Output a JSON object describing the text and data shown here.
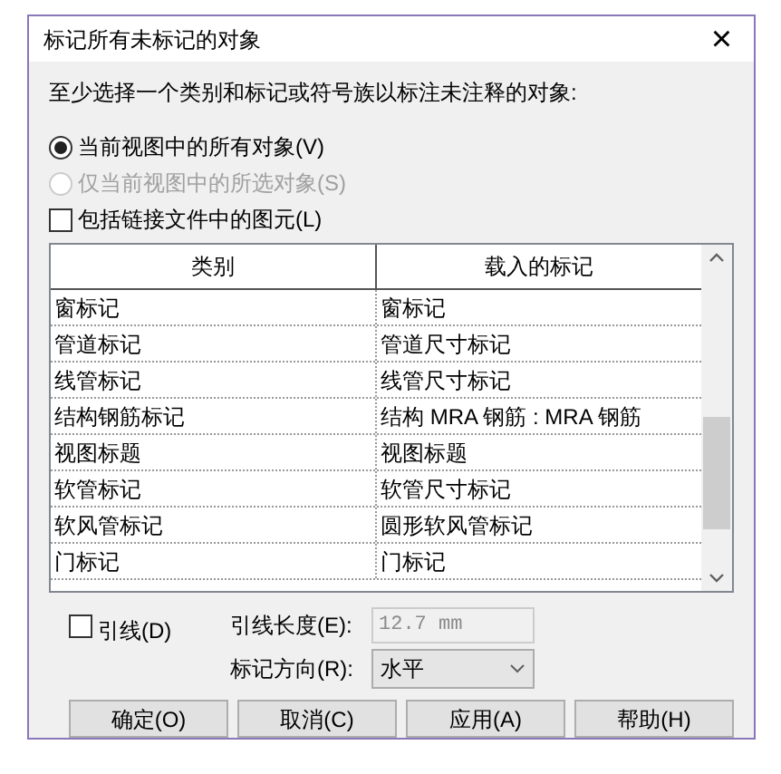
{
  "window": {
    "title": "标记所有未标记的对象",
    "close": "×"
  },
  "instruction": "至少选择一个类别和标记或符号族以标注未注释的对象:",
  "scope_options": [
    {
      "label": "当前视图中的所有对象(V)",
      "selected": true,
      "disabled": false
    },
    {
      "label": "仅当前视图中的所选对象(S)",
      "selected": false,
      "disabled": true
    }
  ],
  "include_linked": {
    "label": "包括链接文件中的图元(L)",
    "checked": false
  },
  "table": {
    "columns": [
      "类别",
      "载入的标记"
    ],
    "rows": [
      [
        "窗标记",
        "窗标记"
      ],
      [
        "管道标记",
        "管道尺寸标记"
      ],
      [
        "线管标记",
        "线管尺寸标记"
      ],
      [
        "结构钢筋标记",
        "结构 MRA 钢筋 : MRA 钢筋"
      ],
      [
        "视图标题",
        "视图标题"
      ],
      [
        "软管标记",
        "软管尺寸标记"
      ],
      [
        "软风管标记",
        "圆形软风管标记"
      ],
      [
        "门标记",
        "门标记"
      ]
    ]
  },
  "leader": {
    "label": "引线(D)",
    "checked": false
  },
  "leader_length": {
    "label": "引线长度(E):",
    "value": "12.7 mm",
    "disabled": true
  },
  "tag_orientation": {
    "label": "标记方向(R):",
    "value": "水平"
  },
  "buttons": [
    "确定(O)",
    "取消(C)",
    "应用(A)",
    "帮助(H)"
  ]
}
